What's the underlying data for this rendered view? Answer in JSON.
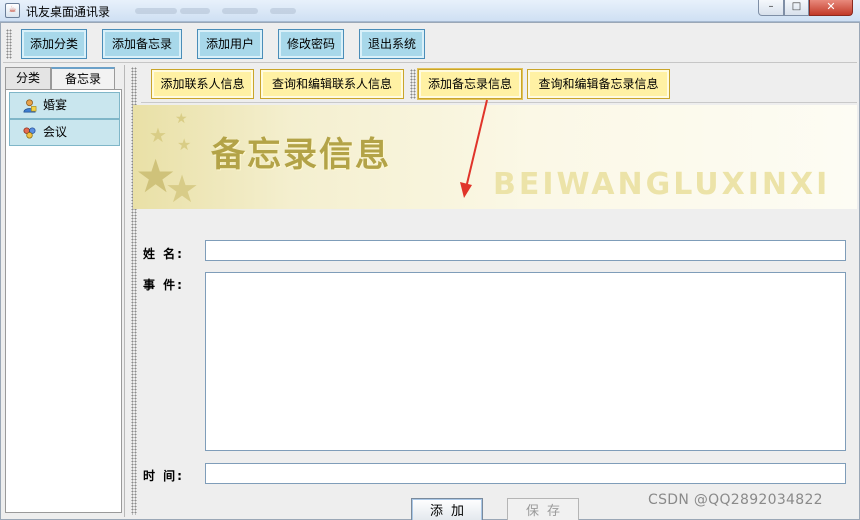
{
  "window": {
    "title": "讯友桌面通讯录",
    "minimize": "–",
    "maximize": "□",
    "close": "✕"
  },
  "toolbar": {
    "add_category": "添加分类",
    "add_memo": "添加备忘录",
    "add_user": "添加用户",
    "change_password": "修改密码",
    "exit_system": "退出系统"
  },
  "left_tabs": {
    "category": "分类",
    "memo": "备忘录"
  },
  "memo_list": {
    "items": [
      {
        "label": "婚宴",
        "icon": "person-icon"
      },
      {
        "label": "会议",
        "icon": "group-icon"
      }
    ]
  },
  "sub_toolbar": {
    "add_contact": "添加联系人信息",
    "query_edit_contact": "查询和编辑联系人信息",
    "add_memo_info": "添加备忘录信息",
    "query_edit_memo": "查询和编辑备忘录信息"
  },
  "banner": {
    "title": "备忘录信息",
    "subtitle": "BEIWANGLUXINXI"
  },
  "form": {
    "name_label": "姓  名:",
    "event_label": "事  件:",
    "time_label": "时  间:",
    "name_value": "",
    "event_value": "",
    "time_value": ""
  },
  "actions": {
    "add": "添加",
    "save": "保存"
  },
  "watermark": "CSDN @QQ2892034822",
  "colors": {
    "toolbar_button": "#a8d8ea",
    "sub_button": "#fff1a4",
    "list_item": "#c9e6ee",
    "banner_text": "#b3a347",
    "arrow": "#e0342a"
  }
}
